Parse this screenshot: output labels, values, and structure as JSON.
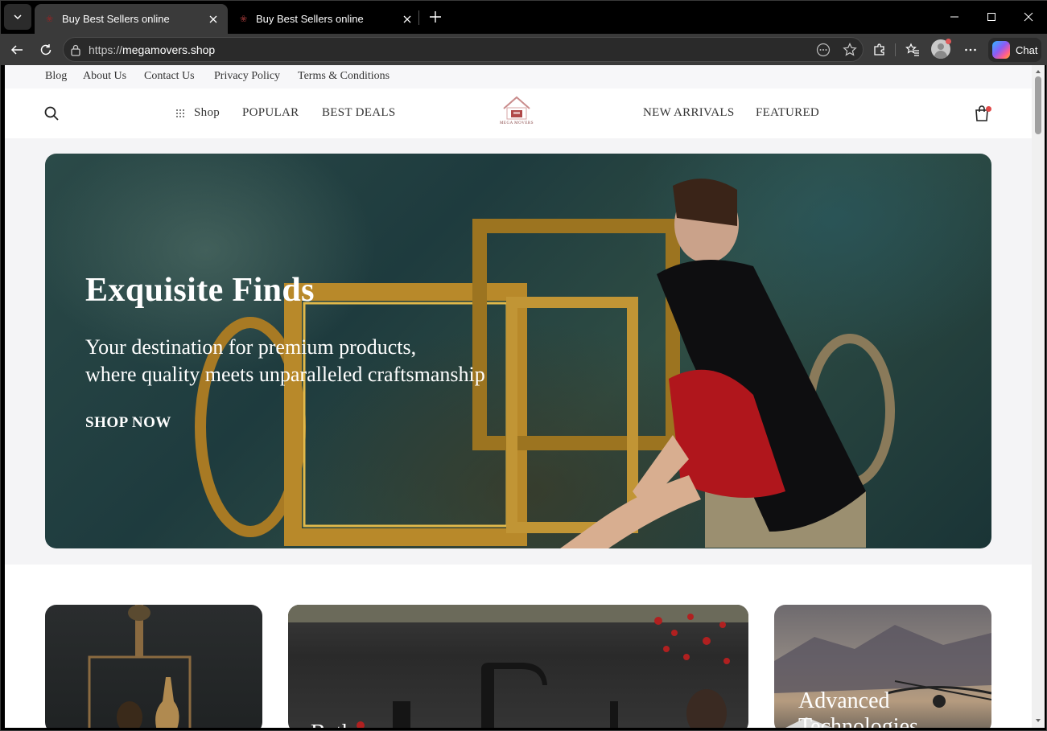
{
  "browser": {
    "tabs": [
      {
        "title": "Buy Best Sellers online",
        "active": true
      },
      {
        "title": "Buy Best Sellers online",
        "active": false
      }
    ],
    "url_scheme": "https://",
    "url_host": "megamovers.shop",
    "chat_label": "Chat"
  },
  "site": {
    "top_links": [
      "Blog",
      "About Us",
      "Contact Us",
      "Privacy Policy",
      "Terms & Conditions"
    ],
    "nav_left": {
      "shop": "Shop",
      "popular": "POPULAR",
      "best_deals": "BEST DEALS"
    },
    "nav_right": {
      "new_arrivals": "NEW ARRIVALS",
      "featured": "FEATURED"
    },
    "logo_text": "MEGA MOVERS",
    "hero": {
      "title": "Exquisite Finds",
      "subtitle_line1": "Your destination for premium products,",
      "subtitle_line2": "where quality meets unparalleled craftsmanship",
      "cta": "SHOP NOW"
    },
    "cards": [
      {
        "label": ""
      },
      {
        "label": "Bath"
      },
      {
        "label": "Advanced Technologies"
      }
    ]
  },
  "colors": {
    "accent_dot": "#e04848",
    "browser_chrome": "#3a3a3a"
  }
}
